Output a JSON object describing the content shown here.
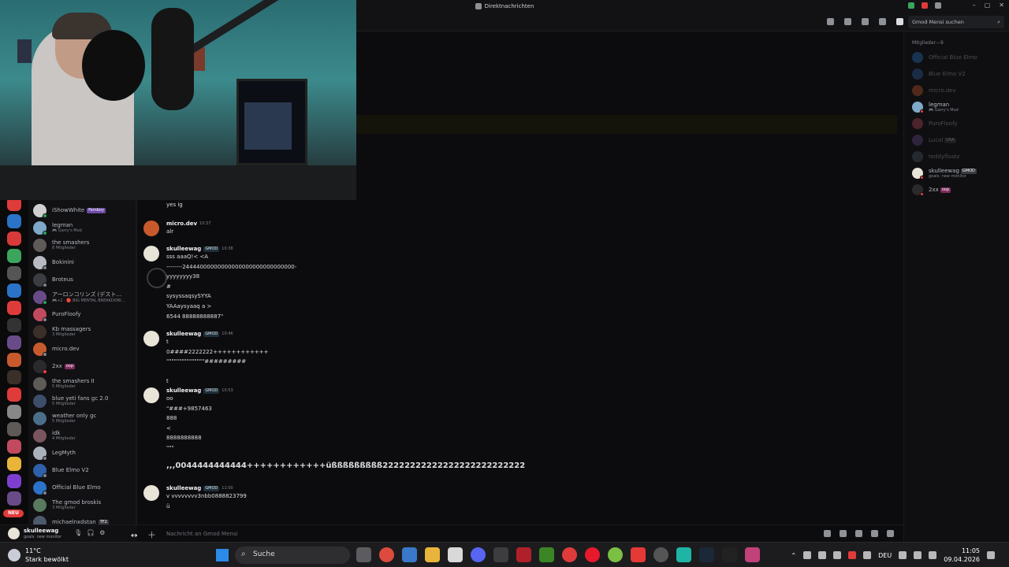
{
  "window": {
    "title": "Direktnachrichten"
  },
  "toolbar": {
    "search_placeholder": "Gmod Mensi suchen"
  },
  "dm_list": [
    {
      "name": "iShowWhite",
      "tag": "Femboy",
      "tag_style": "purple",
      "sub": "",
      "color": "#cfcfcf",
      "status": "#23a55a"
    },
    {
      "name": "legman",
      "tag": "",
      "sub": "🎮 Garry's Mod",
      "color": "#7fa9c8",
      "status": "#23a55a"
    },
    {
      "name": "the smashers",
      "tag": "",
      "sub": "8 Mitglieder",
      "color": "#5e5a58",
      "status": ""
    },
    {
      "name": "Bokinini",
      "tag": "",
      "sub": "",
      "color": "#b8bcc2",
      "status": "#80848e"
    },
    {
      "name": "Broteus",
      "tag": "",
      "sub": "",
      "color": "#3a3d41",
      "status": "#80848e"
    },
    {
      "name": "アーロンコリンズ (デスト…",
      "tag": "",
      "sub": "🎮+2 · 🔴 BIG MENTAL BREAKDOW…",
      "color": "#6a4b8a",
      "status": "#23a55a"
    },
    {
      "name": "PuroFloofy",
      "tag": "",
      "sub": "",
      "color": "#c24a5f",
      "status": "#80848e"
    },
    {
      "name": "Kb massagers",
      "tag": "",
      "sub": "3 Mitglieder",
      "color": "#3b2f2a",
      "status": ""
    },
    {
      "name": "micro.dev",
      "tag": "",
      "sub": "",
      "color": "#c75a2d",
      "status": "#80848e"
    },
    {
      "name": "2xx",
      "tag": "oop",
      "tag_style": "pink",
      "sub": "",
      "color": "#2a2a2c",
      "status": "#f23f43"
    },
    {
      "name": "the smashers II",
      "tag": "",
      "sub": "5 Mitglieder",
      "color": "#5e5a58",
      "status": ""
    },
    {
      "name": "blue yeti fans gc 2.0",
      "tag": "",
      "sub": "5 Mitglieder",
      "color": "#3d4e6a",
      "status": ""
    },
    {
      "name": "weather only gc",
      "tag": "",
      "sub": "5 Mitglieder",
      "color": "#4b6f8a",
      "status": ""
    },
    {
      "name": "idk",
      "tag": "",
      "sub": "4 Mitglieder",
      "color": "#7a5560",
      "status": ""
    },
    {
      "name": "LegMyth",
      "tag": "",
      "sub": "",
      "color": "#a9b2bb",
      "status": "#80848e"
    },
    {
      "name": "Blue Elmo V2",
      "tag": "",
      "sub": "",
      "color": "#2f5fa8",
      "status": "#80848e"
    },
    {
      "name": "Official Blue Elmo",
      "tag": "",
      "sub": "",
      "color": "#2b73c9",
      "status": "#80848e"
    },
    {
      "name": "The gmod broskis",
      "tag": "",
      "sub": "3 Mitglieder",
      "color": "#587a5f",
      "status": ""
    },
    {
      "name": "michaelnxdstan",
      "tag": "TF2",
      "tag_style": "gray",
      "sub": "",
      "color": "#4c5a6b",
      "status": "#80848e"
    }
  ],
  "chat": {
    "messages": [
      {
        "author": "",
        "tag": "",
        "time": "",
        "lines": [
          "yes ig"
        ],
        "avatar_color": "#e9e4d8"
      },
      {
        "author": "micro.dev",
        "tag": "",
        "time": "10:37",
        "lines": [
          "alr"
        ],
        "avatar_color": "#c75a2d"
      },
      {
        "author": "skulleewag",
        "tag": "GMOD",
        "time": "10:38",
        "lines": [
          "sss aaaQ!< <A",
          "--------24444000000000000000000000000000-",
          "yyyyyyyy38",
          "#",
          "sysyssaqsySYYA",
          "YAAaysyaaq a >",
          "6544   88888888887\""
        ],
        "avatar_color": "#e9e4d8"
      },
      {
        "author": "skulleewag",
        "tag": "GMOD",
        "time": "10:46",
        "lines": [
          "t",
          "0####2222222++++++++++++",
          "\"\"\"\"\"\"\"\"\"\"\"\"\"\"\"#########",
          "",
          "t"
        ],
        "avatar_color": "#e9e4d8"
      },
      {
        "author": "skulleewag",
        "tag": "GMOD",
        "time": "10:53",
        "lines": [
          "oo",
          "\"###+9857463",
          "888",
          "<",
          "8888888888",
          "\"\"\""
        ],
        "avatar_color": "#e9e4d8"
      },
      {
        "author": "",
        "tag": "",
        "time": "",
        "lines": [
          ",,,0044444444444++++++++++++üßßßßßßßßß22222222222222222222222222"
        ],
        "avatar_color": ""
      },
      {
        "author": "skulleewag",
        "tag": "GMOD",
        "time": "11:00",
        "lines": [
          "v vvvvvvvv3nbb0888823799",
          "ü"
        ],
        "avatar_color": "#e9e4d8"
      }
    ],
    "input_placeholder": "Nachricht an Gmod Mensi"
  },
  "user_panel": {
    "name": "skulleewag",
    "status": "goals: new monitor"
  },
  "members": {
    "header": "Mitglieder—9",
    "list": [
      {
        "name": "Official Blue Elmo",
        "sub": "",
        "tag": "",
        "online": false,
        "color": "#2b73c9"
      },
      {
        "name": "Blue Elmo V2",
        "sub": "",
        "tag": "",
        "online": false,
        "color": "#2f5fa8"
      },
      {
        "name": "micro.dev",
        "sub": "",
        "tag": "",
        "online": false,
        "color": "#c75a2d"
      },
      {
        "name": "legman",
        "sub": "🎮 Garry's Mod",
        "tag": "",
        "online": true,
        "color": "#7fa9c8"
      },
      {
        "name": "PuroFloofy",
        "sub": "",
        "tag": "",
        "online": false,
        "color": "#c24a5f"
      },
      {
        "name": "Lucal",
        "sub": "",
        "tag": "USA",
        "online": false,
        "color": "#6a4b8a"
      },
      {
        "name": "teddyfloatz",
        "sub": "",
        "tag": "",
        "online": false,
        "color": "#4c5a6b"
      },
      {
        "name": "skulleewag",
        "sub": "goals: new monitor",
        "tag": "GMOD",
        "online": true,
        "color": "#e9e4d8"
      },
      {
        "name": "2xx",
        "sub": "",
        "tag": "oop",
        "online": true,
        "color": "#2a2a2c"
      }
    ]
  },
  "taskbar": {
    "temp": "11°C",
    "weather": "Stark bewölkt",
    "search": "Suche",
    "lang": "DEU",
    "time": "11:05",
    "date": "09.04.2026"
  },
  "rail_badges": {
    "neu": "NEU"
  }
}
